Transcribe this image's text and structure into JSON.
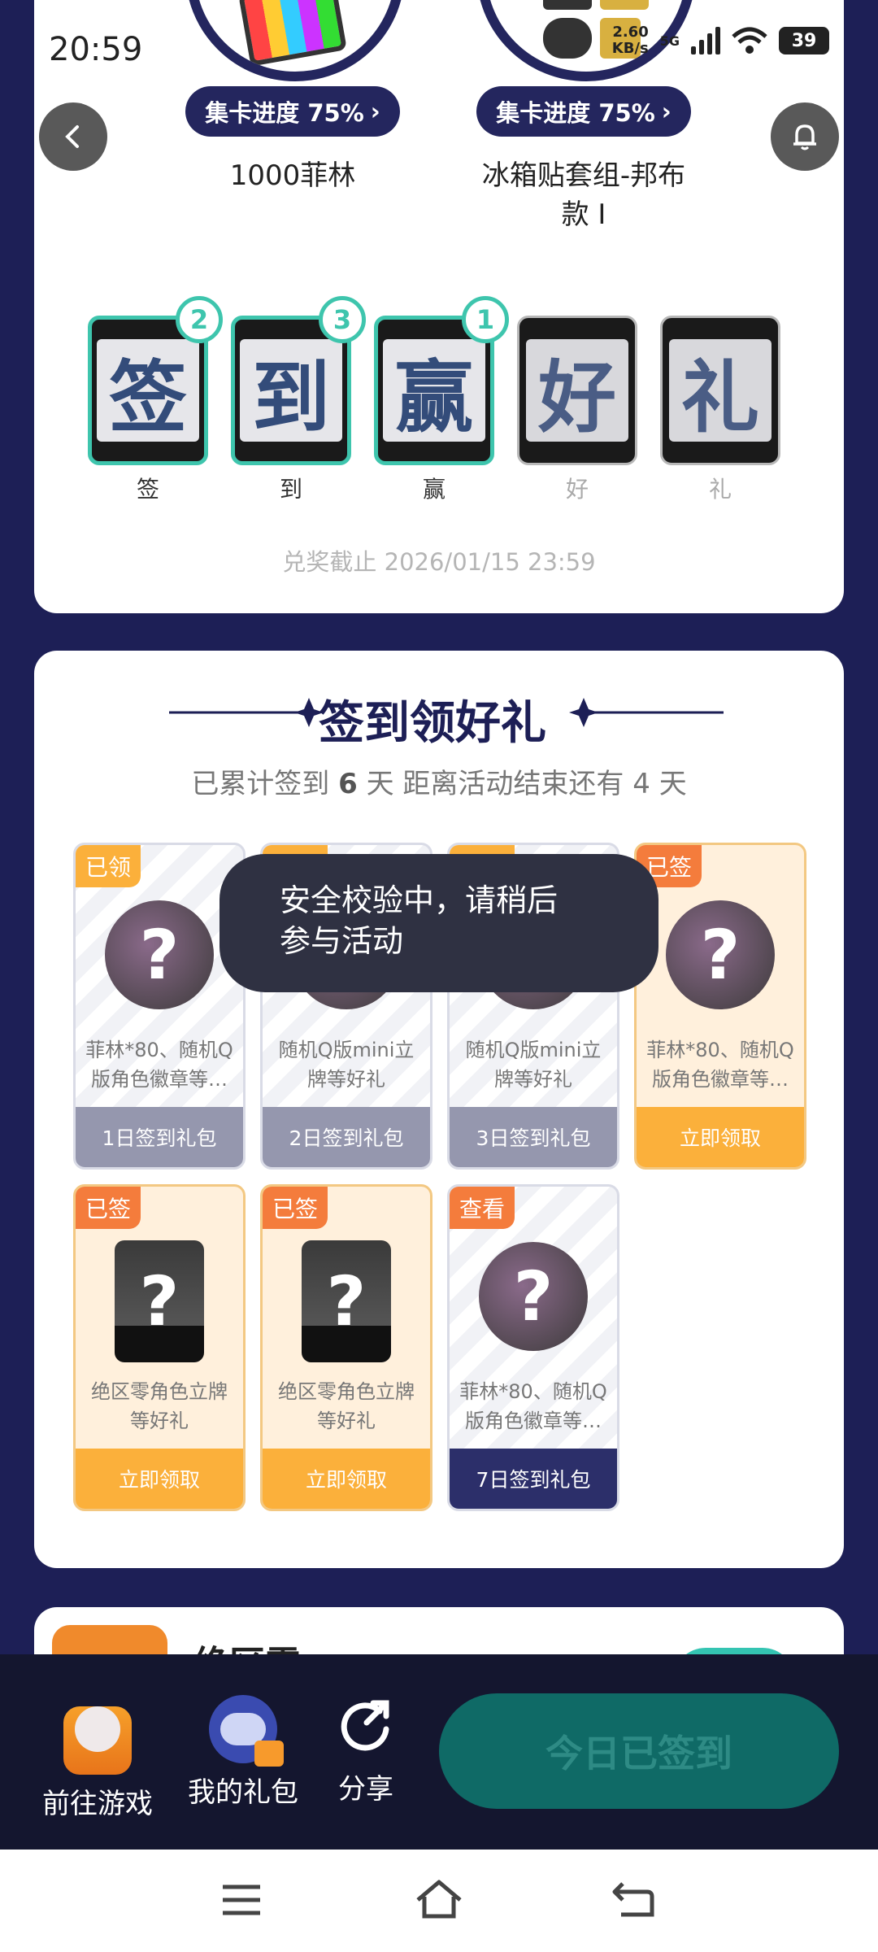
{
  "status": {
    "time": "20:59",
    "net_speed_value": "2.60",
    "net_speed_unit": "KB/s",
    "network": "5G",
    "battery": "39"
  },
  "prizes": [
    {
      "progress_label": "集卡进度 75%",
      "name": "1000菲林"
    },
    {
      "progress_label": "集卡进度 75%",
      "name_line1": "冰箱贴套组-邦布",
      "name_line2": "款 I"
    }
  ],
  "cards": [
    {
      "char": "签",
      "label": "签",
      "count": "2",
      "active": true
    },
    {
      "char": "到",
      "label": "到",
      "count": "3",
      "active": true
    },
    {
      "char": "赢",
      "label": "赢",
      "count": "1",
      "active": true
    },
    {
      "char": "好",
      "label": "好",
      "count": "",
      "active": false
    },
    {
      "char": "礼",
      "label": "礼",
      "count": "",
      "active": false
    }
  ],
  "deadline": "兑奖截止 2026/01/15 23:59",
  "signin": {
    "title": "签到领好礼",
    "sub_prefix": "已累计签到",
    "sub_days": "6",
    "sub_mid": "天  距离活动结束还有",
    "sub_remain": "4",
    "sub_suffix": "天"
  },
  "gifts": [
    {
      "tag": "已领",
      "desc": "菲林*80、随机Q版角色徽章等…",
      "footer": "1日签到礼包"
    },
    {
      "tag": "已领",
      "desc": "随机Q版mini立牌等好礼",
      "footer": "2日签到礼包"
    },
    {
      "tag": "已领",
      "desc": "随机Q版mini立牌等好礼",
      "footer": "3日签到礼包"
    },
    {
      "tag": "已签",
      "desc": "菲林*80、随机Q版角色徽章等…",
      "footer": "立即领取"
    },
    {
      "tag": "已签",
      "desc": "绝区零角色立牌等好礼",
      "footer": "立即领取"
    },
    {
      "tag": "已签",
      "desc": "绝区零角色立牌等好礼",
      "footer": "立即领取"
    },
    {
      "tag": "查看",
      "desc": "菲林*80、随机Q版角色徽章等…",
      "footer": "7日签到礼包"
    }
  ],
  "toast": {
    "line1": "安全校验中，请稍后",
    "line2": "参与活动"
  },
  "game_partial_title": "绝区零",
  "bottom": {
    "go_game": "前往游戏",
    "my_gifts": "我的礼包",
    "share": "分享",
    "checkin": "今日已签到"
  },
  "colors": {
    "navy": "#1d1f56",
    "teal": "#3ec5ad",
    "orange": "#fbb03b",
    "tag_orange": "#f47c3c",
    "grey_footer": "#9597ae"
  }
}
